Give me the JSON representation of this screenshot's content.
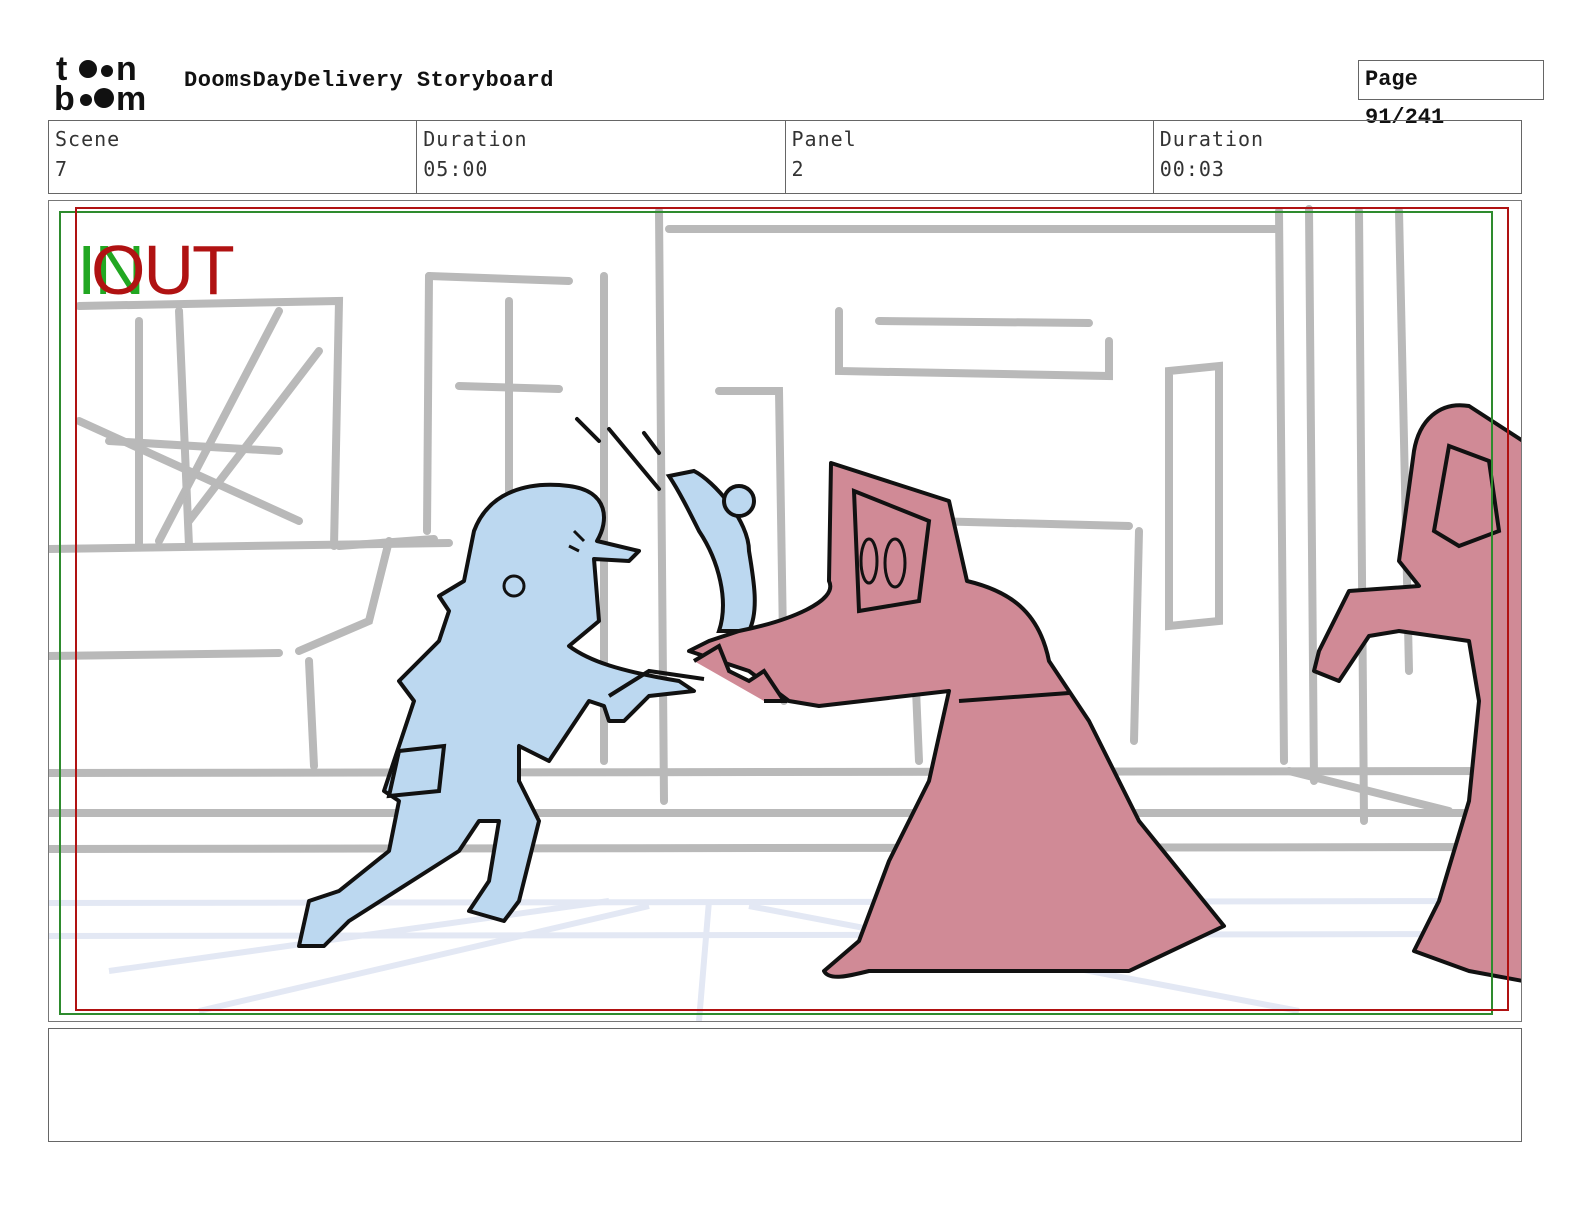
{
  "header": {
    "logo_text": "toonboom",
    "title": "DoomsDayDelivery Storyboard",
    "page_label": "Page",
    "page_value": "91/241"
  },
  "info": {
    "scene_label": "Scene",
    "scene_value": "7",
    "scene_duration_label": "Duration",
    "scene_duration_value": "05:00",
    "panel_label": "Panel",
    "panel_value": "2",
    "panel_duration_label": "Duration",
    "panel_duration_value": "00:03"
  },
  "panel": {
    "in_label": "IN",
    "out_label": "OUT",
    "colors": {
      "safe_green": "#2e8b2e",
      "safe_red": "#b01212",
      "courier_blue": "#bcd8f0",
      "cultist_pink": "#d08a96",
      "sketch_gray": "#b8b8b8",
      "ink": "#111111"
    }
  },
  "notes": {
    "text": ""
  }
}
